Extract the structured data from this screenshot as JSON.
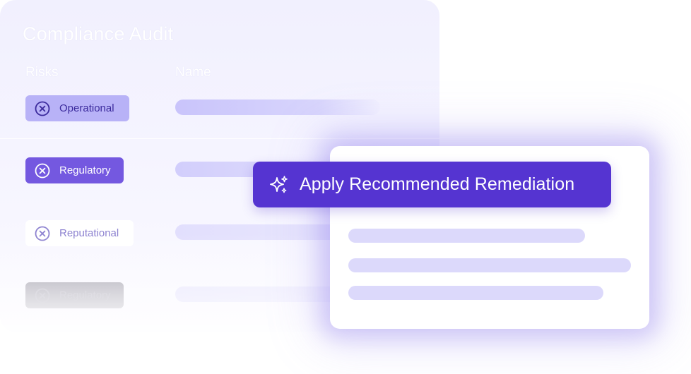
{
  "audit": {
    "title": "Compliance Audit",
    "columns": {
      "risks": "Risks",
      "name": "Name"
    },
    "rows": [
      {
        "risk": "Operational"
      },
      {
        "risk": "Regulatory"
      },
      {
        "risk": "Reputational"
      },
      {
        "risk": "Regulatory"
      }
    ]
  },
  "remediation": {
    "action_label": "Apply Recommended Remediation",
    "action_icon": "sparkle-icon"
  },
  "colors": {
    "primary": "#5534d1",
    "badge_selected": "#7458e0",
    "badge_light": "#b8b2f7",
    "placeholder": "#dcd9fb"
  }
}
